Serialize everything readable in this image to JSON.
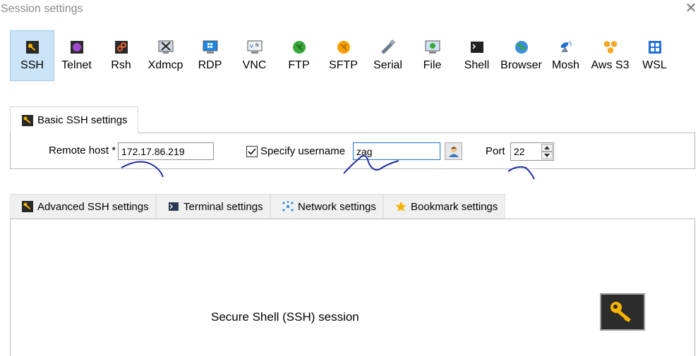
{
  "window": {
    "title": "Session settings"
  },
  "session_types": [
    {
      "label": "SSH",
      "icon": "ssh-key-icon",
      "selected": true
    },
    {
      "label": "Telnet",
      "icon": "telnet-icon"
    },
    {
      "label": "Rsh",
      "icon": "rsh-icon"
    },
    {
      "label": "Xdmcp",
      "icon": "xdmcp-icon"
    },
    {
      "label": "RDP",
      "icon": "rdp-icon"
    },
    {
      "label": "VNC",
      "icon": "vnc-icon"
    },
    {
      "label": "FTP",
      "icon": "ftp-icon"
    },
    {
      "label": "SFTP",
      "icon": "sftp-icon"
    },
    {
      "label": "Serial",
      "icon": "serial-icon"
    },
    {
      "label": "File",
      "icon": "file-icon"
    },
    {
      "label": "Shell",
      "icon": "shell-icon"
    },
    {
      "label": "Browser",
      "icon": "browser-icon"
    },
    {
      "label": "Mosh",
      "icon": "mosh-icon"
    },
    {
      "label": "Aws S3",
      "icon": "aws-s3-icon"
    },
    {
      "label": "WSL",
      "icon": "wsl-icon"
    }
  ],
  "basic": {
    "tab_label": "Basic SSH settings",
    "remote_host_label": "Remote host *",
    "remote_host_value": "172.17.86.219",
    "specify_username_label": "Specify username",
    "specify_username_checked": true,
    "username_value": "zag",
    "port_label": "Port",
    "port_value": "22"
  },
  "advanced_tabs": [
    {
      "label": "Advanced SSH settings",
      "icon": "key-icon"
    },
    {
      "label": "Terminal settings",
      "icon": "terminal-icon"
    },
    {
      "label": "Network settings",
      "icon": "network-icon"
    },
    {
      "label": "Bookmark settings",
      "icon": "star-icon"
    }
  ],
  "panel": {
    "description": "Secure Shell (SSH) session",
    "icon": "ssh-key-icon"
  },
  "colors": {
    "selected_bg": "#cce4f7",
    "key_yellow": "#f5b400",
    "annotation_ink": "#1e2aa6"
  }
}
